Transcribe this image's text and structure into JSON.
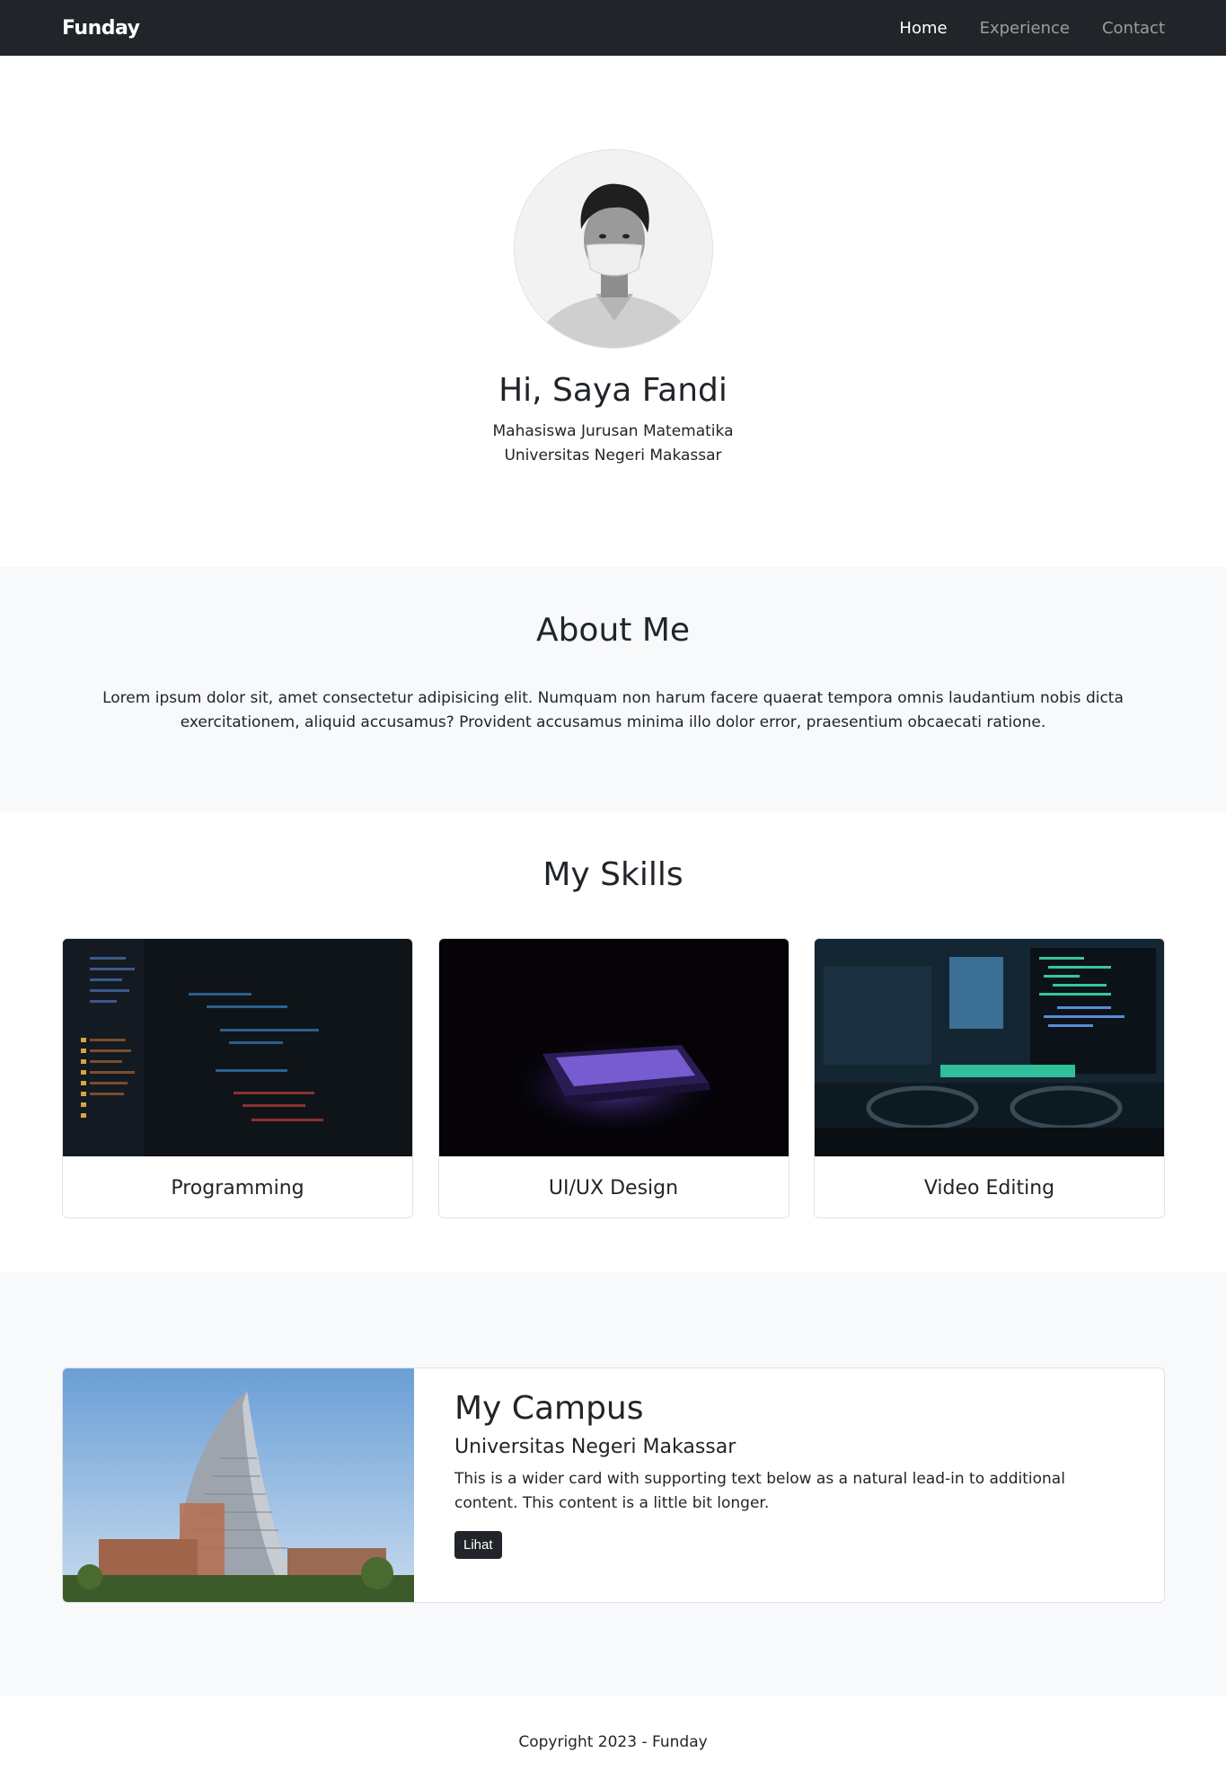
{
  "nav": {
    "brand": "Funday",
    "links": [
      "Home",
      "Experience",
      "Contact"
    ]
  },
  "hero": {
    "title": "Hi, Saya Fandi",
    "line1": "Mahasiswa Jurusan Matematika",
    "line2": "Universitas Negeri Makassar"
  },
  "about": {
    "title": "About Me",
    "text": "Lorem ipsum dolor sit, amet consectetur adipisicing elit. Numquam non harum facere quaerat tempora omnis laudantium nobis dicta exercitationem, aliquid accusamus? Provident accusamus minima illo dolor error, praesentium obcaecati ratione."
  },
  "skills": {
    "title": "My Skills",
    "items": [
      "Programming",
      "UI/UX Design",
      "Video Editing"
    ]
  },
  "campus": {
    "title": "My Campus",
    "subtitle": "Universitas Negeri Makassar",
    "text": "This is a wider card with supporting text below as a natural lead-in to additional content. This content is a little bit longer.",
    "button": "Lihat"
  },
  "footer": {
    "text": "Copyright 2023 - Funday"
  },
  "colors": {
    "navbar": "#212529",
    "section_alt": "#f8f9fa",
    "button": "#212529"
  }
}
